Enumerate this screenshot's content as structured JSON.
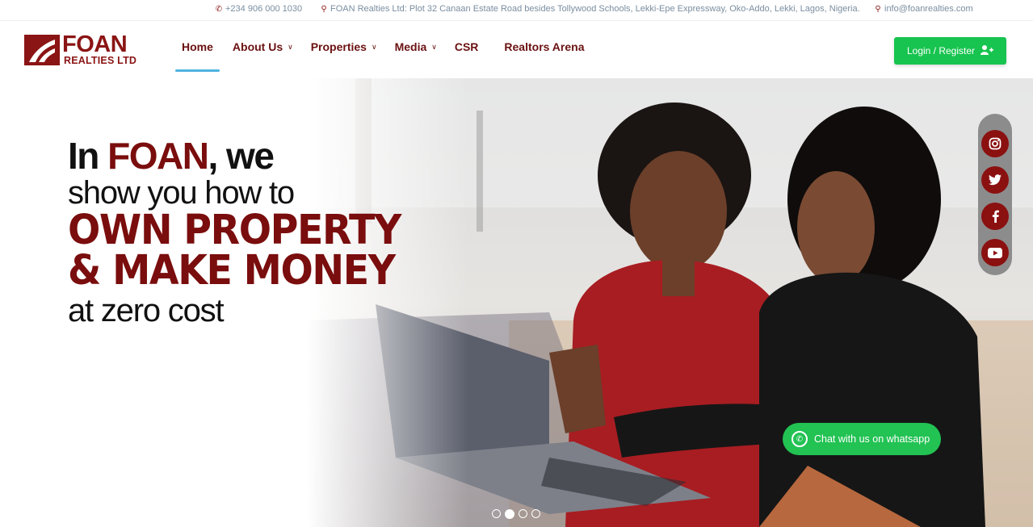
{
  "topbar": {
    "phone": "+234 906 000 1030",
    "address": "FOAN Realties Ltd: Plot 32 Canaan Estate Road besides Tollywood Schools, Lekki-Epe Expressway, Oko-Addo, Lekki, Lagos, Nigeria.",
    "email": "info@foanrealties.com",
    "phone_icon": "phone-icon",
    "address_icon": "map-pin-icon",
    "email_icon": "map-pin-icon"
  },
  "logo": {
    "brand": "FOAN",
    "sub": "REALTIES LTD"
  },
  "nav": {
    "items": [
      {
        "label": "Home",
        "active": true,
        "dropdown": false
      },
      {
        "label": "About Us",
        "dropdown": true
      },
      {
        "label": "Properties",
        "dropdown": true
      },
      {
        "label": "Media",
        "dropdown": true
      },
      {
        "label": "CSR",
        "dropdown": false
      },
      {
        "label": "Realtors Arena",
        "dropdown": false
      }
    ]
  },
  "login": {
    "label": "Login / Register",
    "icon": "user-plus-icon"
  },
  "hero": {
    "line1_pre": "In ",
    "line1_brand": "FOAN",
    "line1_post": ", we",
    "line2": "show you how to",
    "line3": "OWN PROPERTY",
    "line4": "& MAKE MONEY",
    "line5": "at zero cost"
  },
  "social": [
    "instagram-icon",
    "twitter-icon",
    "facebook-icon",
    "youtube-icon"
  ],
  "whatsapp": {
    "label": "Chat with us on whatsapp",
    "icon": "whatsapp-icon"
  },
  "carousel": {
    "total": 4,
    "active": 2
  },
  "colors": {
    "brand": "#7a0d0d",
    "accent_green": "#17c44f",
    "nav_underline": "#4fb3e0"
  }
}
